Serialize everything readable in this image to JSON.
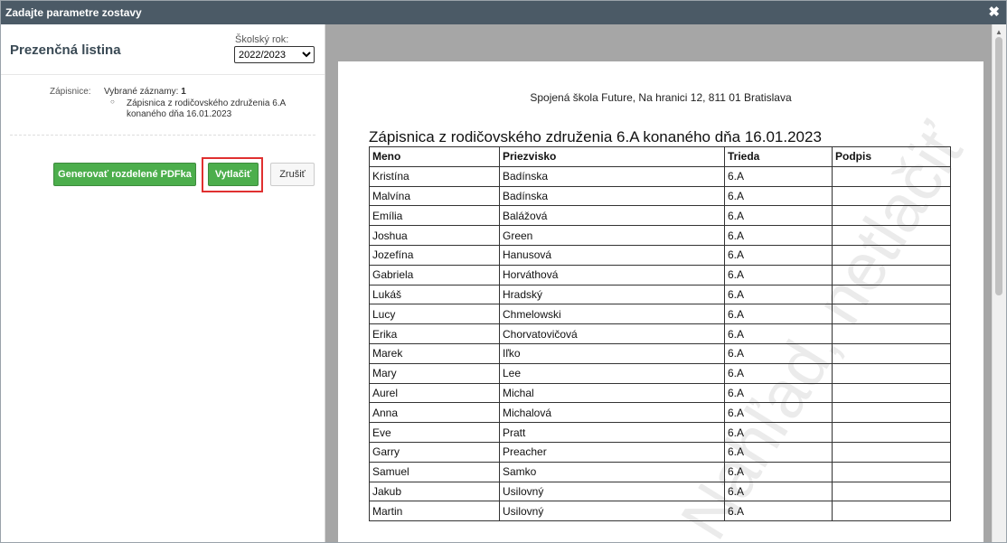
{
  "dialog": {
    "title": "Zadajte parametre zostavy",
    "close_symbol": "✖"
  },
  "left_panel": {
    "title": "Prezenčná listina",
    "year_label": "Školský rok:",
    "year_value": "2022/2023",
    "criteria_label": "Zápisnice:",
    "selected_label": "Vybrané záznamy:",
    "selected_count": "1",
    "selected_item": "Zápisnica z rodičovského združenia 6.A konaného dňa 16.01.2023",
    "btn_generate": "Generovať rozdelené PDFka",
    "btn_print": "Vytlačiť",
    "btn_cancel": "Zrušiť"
  },
  "preview": {
    "school_line": "Spojená škola Future, Na hranici 12, 811 01 Bratislava",
    "doc_title": "Zápisnica z rodičovského združenia 6.A konaného dňa 16.01.2023",
    "watermark": "Nahľad, netlačiť",
    "columns": [
      "Meno",
      "Priezvisko",
      "Trieda",
      "Podpis"
    ],
    "rows": [
      {
        "meno": "Kristína",
        "priezvisko": "Badínska",
        "trieda": "6.A",
        "podpis": ""
      },
      {
        "meno": "Malvína",
        "priezvisko": "Badínska",
        "trieda": "6.A",
        "podpis": ""
      },
      {
        "meno": "Emília",
        "priezvisko": "Balážová",
        "trieda": "6.A",
        "podpis": ""
      },
      {
        "meno": "Joshua",
        "priezvisko": "Green",
        "trieda": "6.A",
        "podpis": ""
      },
      {
        "meno": "Jozefína",
        "priezvisko": "Hanusová",
        "trieda": "6.A",
        "podpis": ""
      },
      {
        "meno": "Gabriela",
        "priezvisko": "Horváthová",
        "trieda": "6.A",
        "podpis": ""
      },
      {
        "meno": "Lukáš",
        "priezvisko": "Hradský",
        "trieda": "6.A",
        "podpis": ""
      },
      {
        "meno": "Lucy",
        "priezvisko": "Chmelowski",
        "trieda": "6.A",
        "podpis": ""
      },
      {
        "meno": "Erika",
        "priezvisko": "Chorvatovičová",
        "trieda": "6.A",
        "podpis": ""
      },
      {
        "meno": "Marek",
        "priezvisko": "Iľko",
        "trieda": "6.A",
        "podpis": ""
      },
      {
        "meno": "Mary",
        "priezvisko": "Lee",
        "trieda": "6.A",
        "podpis": ""
      },
      {
        "meno": "Aurel",
        "priezvisko": "Michal",
        "trieda": "6.A",
        "podpis": ""
      },
      {
        "meno": "Anna",
        "priezvisko": "Michalová",
        "trieda": "6.A",
        "podpis": ""
      },
      {
        "meno": "Eve",
        "priezvisko": "Pratt",
        "trieda": "6.A",
        "podpis": ""
      },
      {
        "meno": "Garry",
        "priezvisko": "Preacher",
        "trieda": "6.A",
        "podpis": ""
      },
      {
        "meno": "Samuel",
        "priezvisko": "Samko",
        "trieda": "6.A",
        "podpis": ""
      },
      {
        "meno": "Jakub",
        "priezvisko": "Usilovný",
        "trieda": "6.A",
        "podpis": ""
      },
      {
        "meno": "Martin",
        "priezvisko": "Usilovný",
        "trieda": "6.A",
        "podpis": ""
      }
    ]
  },
  "colors": {
    "titlebar": "#4b5a66",
    "button_green": "#4cae4c",
    "highlight_red": "#e03030",
    "preview_bg": "#a6a6a6"
  }
}
